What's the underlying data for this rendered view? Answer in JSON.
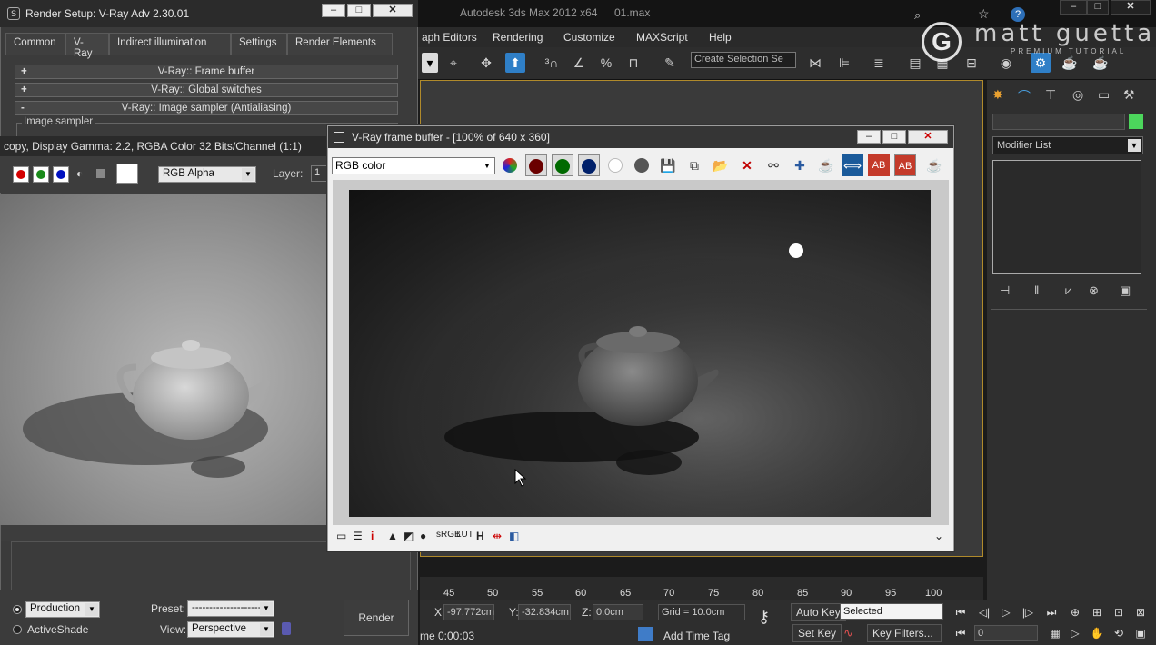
{
  "max_window": {
    "app_title": "Autodesk 3ds Max  2012 x64",
    "file_name": "01.max",
    "menus": [
      "aph Editors",
      "Rendering",
      "Customize",
      "MAXScript",
      "Help"
    ],
    "selection_set_placeholder": "Create Selection Se",
    "watermark_name": "matt guetta",
    "watermark_sub": "PREMIUM TUTORIAL",
    "watermark_logo": "G"
  },
  "command_panel": {
    "modifier_list_label": "Modifier List",
    "object_color": "#4cd65c"
  },
  "timeline": {
    "ticks": [
      "45",
      "50",
      "55",
      "60",
      "65",
      "70",
      "75",
      "80",
      "85",
      "90",
      "95",
      "100"
    ]
  },
  "status_bar": {
    "x_label": "X:",
    "x_value": "-97.772cm",
    "y_label": "Y:",
    "y_value": "-32.834cm",
    "z_label": "Z:",
    "z_value": "0.0cm",
    "grid": "Grid = 10.0cm",
    "auto_key": "Auto Key",
    "selected_option": "Selected",
    "set_key": "Set Key",
    "key_filters": "Key Filters...",
    "time_label": "me  0:00:03",
    "add_time_tag": "Add Time Tag",
    "frame_value": "0"
  },
  "render_setup": {
    "title": "Render Setup: V-Ray Adv 2.30.01",
    "tabs": [
      "Common",
      "V-Ray",
      "Indirect illumination",
      "Settings",
      "Render Elements"
    ],
    "active_tab": "V-Ray",
    "rollouts": [
      {
        "sign": "+",
        "label": "V-Ray:: Frame buffer"
      },
      {
        "sign": "+",
        "label": "V-Ray:: Global switches"
      },
      {
        "sign": "-",
        "label": "V-Ray:: Image sampler (Antialiasing)"
      }
    ],
    "group_label": "Image sampler",
    "bottom": {
      "production_label": "Production",
      "activeshade_label": "ActiveShade",
      "preset_label": "Preset:",
      "preset_value": "--------------------",
      "view_label": "View:",
      "view_value": "Perspective",
      "render_button": "Render"
    }
  },
  "display_window": {
    "title": "copy, Display Gamma: 2.2, RGBA Color 32 Bits/Channel (1:1)",
    "channel_select": "RGB Alpha",
    "layer_label": "Layer:",
    "layer_value": "1"
  },
  "vfb": {
    "title": "V-Ray frame buffer - [100% of 640 x 360]",
    "channel": "RGB color"
  }
}
